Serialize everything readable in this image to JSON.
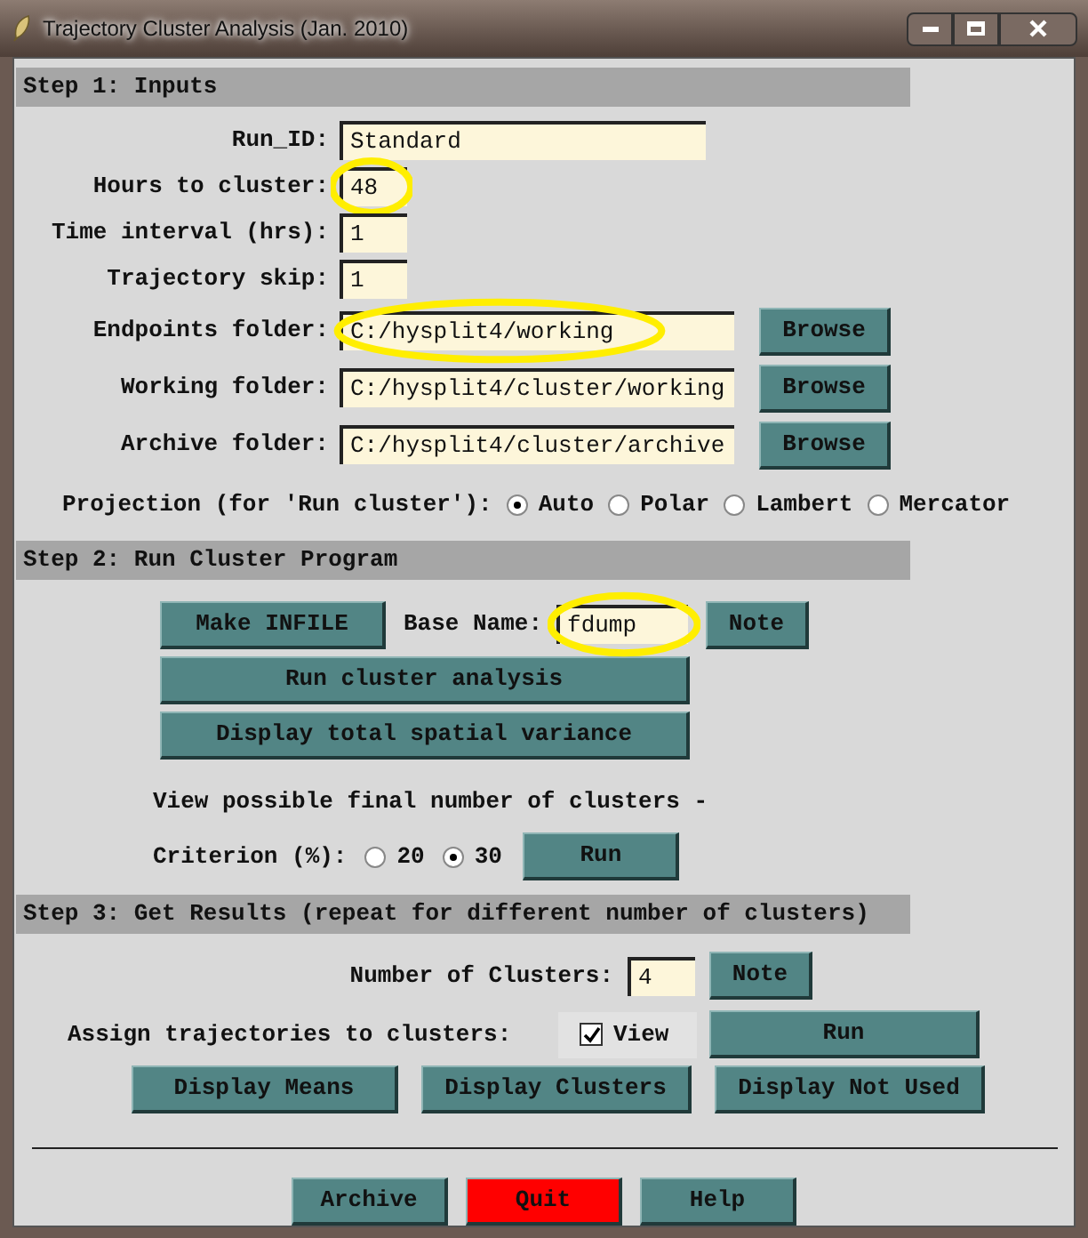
{
  "window": {
    "title": "Trajectory Cluster Analysis (Jan. 2010)"
  },
  "step1": {
    "header": "Step 1: Inputs",
    "fields": [
      {
        "label": "Run_ID:",
        "value": "Standard",
        "kind": "medium",
        "highlighted": false
      },
      {
        "label": "Hours to cluster:",
        "value": "48",
        "kind": "small",
        "highlighted": true
      },
      {
        "label": "Time interval (hrs):",
        "value": "1",
        "kind": "small",
        "highlighted": false
      },
      {
        "label": "Trajectory skip:",
        "value": "1",
        "kind": "small",
        "highlighted": false
      },
      {
        "label": "Endpoints folder:",
        "value": "C:/hysplit4/working",
        "kind": "large",
        "highlighted": true,
        "button": "Browse"
      },
      {
        "label": "Working folder:",
        "value": "C:/hysplit4/cluster/working",
        "kind": "large",
        "highlighted": false,
        "button": "Browse"
      },
      {
        "label": "Archive folder:",
        "value": "C:/hysplit4/cluster/archive",
        "kind": "large",
        "highlighted": false,
        "button": "Browse"
      }
    ],
    "projection": {
      "label": "Projection (for 'Run cluster'):",
      "options": [
        {
          "label": "Auto",
          "selected": true
        },
        {
          "label": "Polar",
          "selected": false
        },
        {
          "label": "Lambert",
          "selected": false
        },
        {
          "label": "Mercator",
          "selected": false
        }
      ]
    }
  },
  "step2": {
    "header": "Step 2: Run Cluster Program",
    "make_button": "Make INFILE",
    "base_name": {
      "label": "Base Name:",
      "value": "fdump",
      "highlighted": true
    },
    "note": "Note",
    "buttons": [
      "Run cluster analysis",
      "Display total spatial variance"
    ],
    "view_text": "View possible final number of clusters -",
    "criterion": {
      "label": "Criterion (%):",
      "options": [
        {
          "label": "20",
          "selected": false
        },
        {
          "label": "30",
          "selected": true
        }
      ],
      "run": "Run"
    }
  },
  "step3": {
    "header": "Step 3: Get Results (repeat for different number of clusters)",
    "clusters": {
      "label": "Number of Clusters:",
      "value": "4"
    },
    "note": "Note",
    "assign": {
      "label": "Assign trajectories to clusters:",
      "view": {
        "label": "View",
        "checked": true
      },
      "run": "Run"
    },
    "display_buttons": [
      "Display Means",
      "Display Clusters",
      "Display Not Used"
    ]
  },
  "bottom_buttons": [
    {
      "label": "Archive",
      "kind": "normal"
    },
    {
      "label": "Quit",
      "kind": "danger"
    },
    {
      "label": "Help",
      "kind": "normal"
    }
  ]
}
